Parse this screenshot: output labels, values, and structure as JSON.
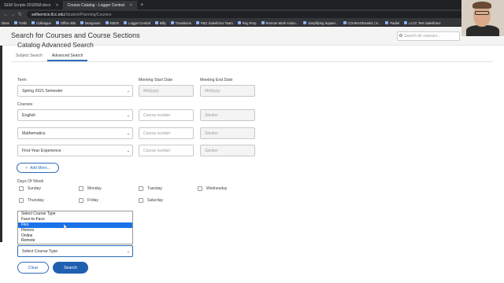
{
  "browser": {
    "tabs": [
      {
        "label": "SEM Scripts 2018SM.docx",
        "active": false
      },
      {
        "label": "Course Catalog - Logger Central",
        "active": true
      }
    ],
    "url_host": "selfservice.llcc.edu",
    "url_path": "/Student/Planning/Courses",
    "bookmarks": [
      "Drive",
      "Trello",
      "Colleague",
      "Office 365",
      "Mongoose",
      "KBOX",
      "Logger Central",
      "Billy",
      "Transitions",
      "P&C Salesforce Team",
      "Reg Prep",
      "Remote Work Action...",
      "Simplifying Square...",
      "COURAGEworks | S...",
      "Padlet",
      "LLCC Test Salesforce"
    ]
  },
  "header": {
    "title": "Search for Courses and Course Sections",
    "search_placeholder": "Search for courses..."
  },
  "subtabs": [
    {
      "label": "Subject Search",
      "active": false
    },
    {
      "label": "Advanced Search",
      "active": true
    }
  ],
  "form": {
    "heading": "Catalog Advanced Search",
    "term_label": "Term",
    "term_value": "Spring 2021 Semester",
    "meeting_start_label": "Meeting Start Date",
    "meeting_end_label": "Meeting End Date",
    "date_placeholder": "M/d/yyyy",
    "courses_label": "Courses",
    "course_rows": [
      {
        "subject": "English",
        "number_placeholder": "Course number",
        "section_placeholder": "Section"
      },
      {
        "subject": "Mathematics",
        "number_placeholder": "Course number",
        "section_placeholder": "Section"
      },
      {
        "subject": "First-Year Experience",
        "number_placeholder": "Course number",
        "section_placeholder": "Section"
      }
    ],
    "add_more": "Add More...",
    "days_label": "Days Of Week",
    "days": [
      "Sunday",
      "Monday",
      "Tuesday",
      "Wednesday",
      "Thursday",
      "Friday",
      "Saturday"
    ],
    "course_type_options": [
      "Select Course Type",
      "Face-to-Face",
      "Flex",
      "Honors",
      "Online",
      "Remote"
    ],
    "course_type_highlighted": "Flex",
    "course_type_value": "Select Course Type",
    "clear_label": "Clear",
    "search_label": "Search"
  }
}
